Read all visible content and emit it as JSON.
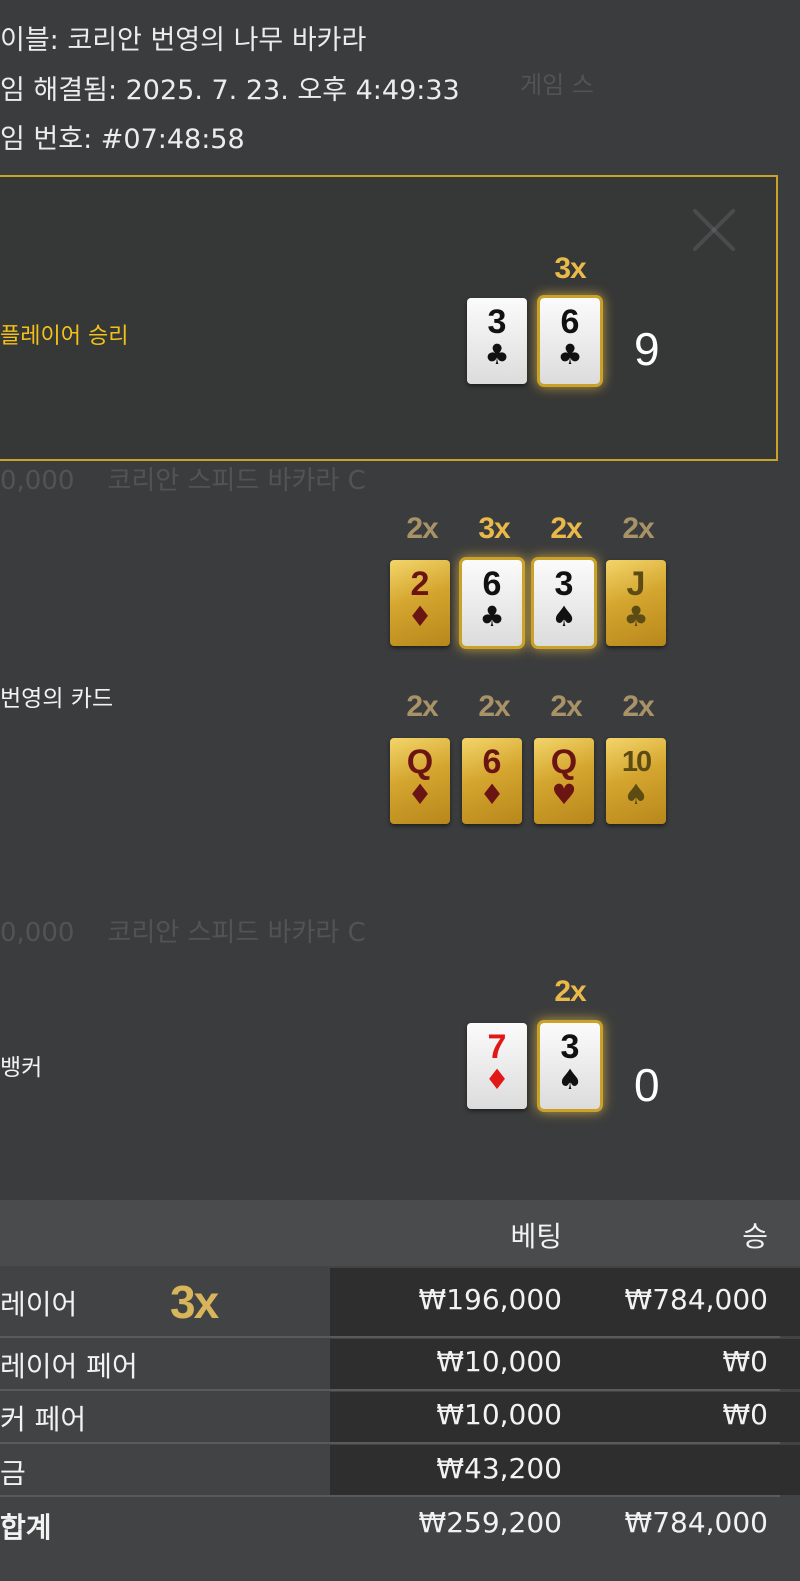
{
  "info": {
    "table": "이블: 코리안 번영의 나무 바카라",
    "resolved": "임 해결됨: 2025. 7. 23. 오후 4:49:33",
    "game_number": "임 번호: #07:48:58"
  },
  "result": {
    "outcome_label": "플레이어 승리",
    "player_multiplier": "3x",
    "player_cards": [
      {
        "rank": "3",
        "suit": "♣",
        "color": "black"
      },
      {
        "rank": "6",
        "suit": "♣",
        "color": "black"
      }
    ],
    "player_score": "9"
  },
  "prosperity": {
    "label": "번영의 카드",
    "row1_multipliers": [
      "2x",
      "3x",
      "2x",
      "2x"
    ],
    "row1_cards": [
      {
        "rank": "2",
        "suit": "♦",
        "style": "gold"
      },
      {
        "rank": "6",
        "suit": "♣",
        "style": "white"
      },
      {
        "rank": "3",
        "suit": "♠",
        "style": "white"
      },
      {
        "rank": "J",
        "suit": "♣",
        "style": "gold"
      }
    ],
    "row2_multipliers": [
      "2x",
      "2x",
      "2x",
      "2x"
    ],
    "row2_cards": [
      {
        "rank": "Q",
        "suit": "♦",
        "style": "gold"
      },
      {
        "rank": "6",
        "suit": "♦",
        "style": "gold"
      },
      {
        "rank": "Q",
        "suit": "♥",
        "style": "gold"
      },
      {
        "rank": "10",
        "suit": "♠",
        "style": "gold"
      }
    ]
  },
  "banker": {
    "label": "뱅커",
    "multiplier": "2x",
    "cards": [
      {
        "rank": "7",
        "suit": "♦",
        "color": "red"
      },
      {
        "rank": "3",
        "suit": "♠",
        "color": "black"
      }
    ],
    "score": "0"
  },
  "bets_table": {
    "header": {
      "bet": "베팅",
      "win": "승"
    },
    "rows": [
      {
        "name": "레이어",
        "bet": "₩196,000",
        "win": "₩784,000",
        "badge": "3x"
      },
      {
        "name": "레이어 페어",
        "bet": "₩10,000",
        "win": "₩0"
      },
      {
        "name": "커 페어",
        "bet": "₩10,000",
        "win": "₩0"
      },
      {
        "name": "금",
        "bet": "₩43,200",
        "win": ""
      },
      {
        "name": "합계",
        "bet": "₩259,200",
        "win": "₩784,000"
      }
    ]
  },
  "colors": {
    "accent": "#c9a227",
    "highlight_text": "#f2c21a",
    "background": "#3b3c3d"
  }
}
